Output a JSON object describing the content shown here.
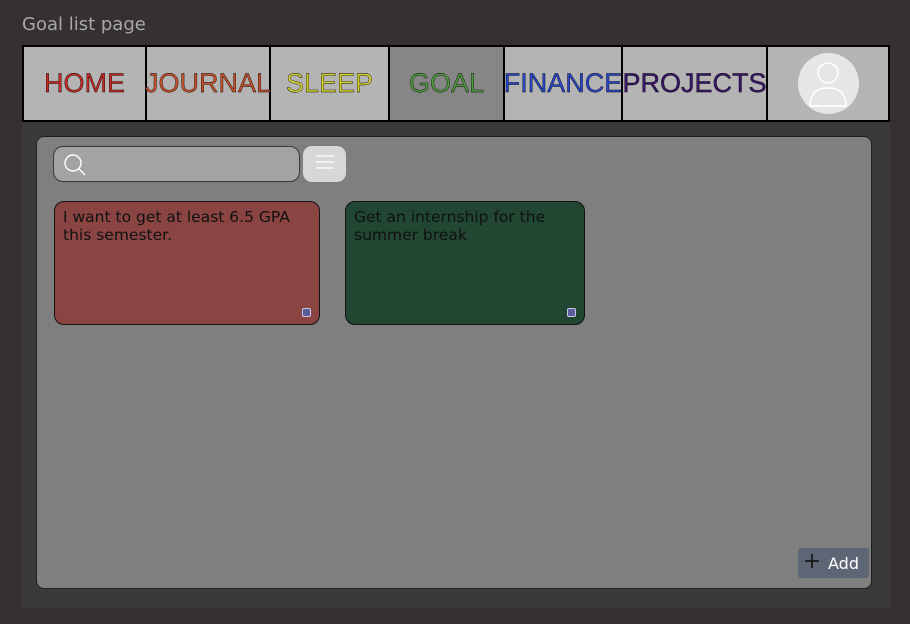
{
  "page_label": "Goal list page",
  "nav": {
    "tabs": [
      {
        "label": "HOME",
        "color": "#c42a26"
      },
      {
        "label": "JOURNAL",
        "color": "#c5512a"
      },
      {
        "label": "SLEEP",
        "color": "#d2cf2e"
      },
      {
        "label": "GOAL",
        "color": "#4f9a3e",
        "active": true
      },
      {
        "label": "FINANCE",
        "color": "#2a47c7"
      },
      {
        "label": "PROJECTS",
        "color": "#3a1668"
      }
    ],
    "avatar_icon": "user-avatar-icon"
  },
  "search": {
    "placeholder": "",
    "icon": "search-icon"
  },
  "menu_icon": "hamburger-icon",
  "goals": [
    {
      "text": "I want to get at least 6.5 GPA this semester.",
      "color": "#8a4543",
      "checked": true
    },
    {
      "text": "Get an internship for the summer break",
      "color": "#214631",
      "checked": true
    }
  ],
  "add_button": {
    "label": "Add",
    "icon": "plus-icon"
  }
}
